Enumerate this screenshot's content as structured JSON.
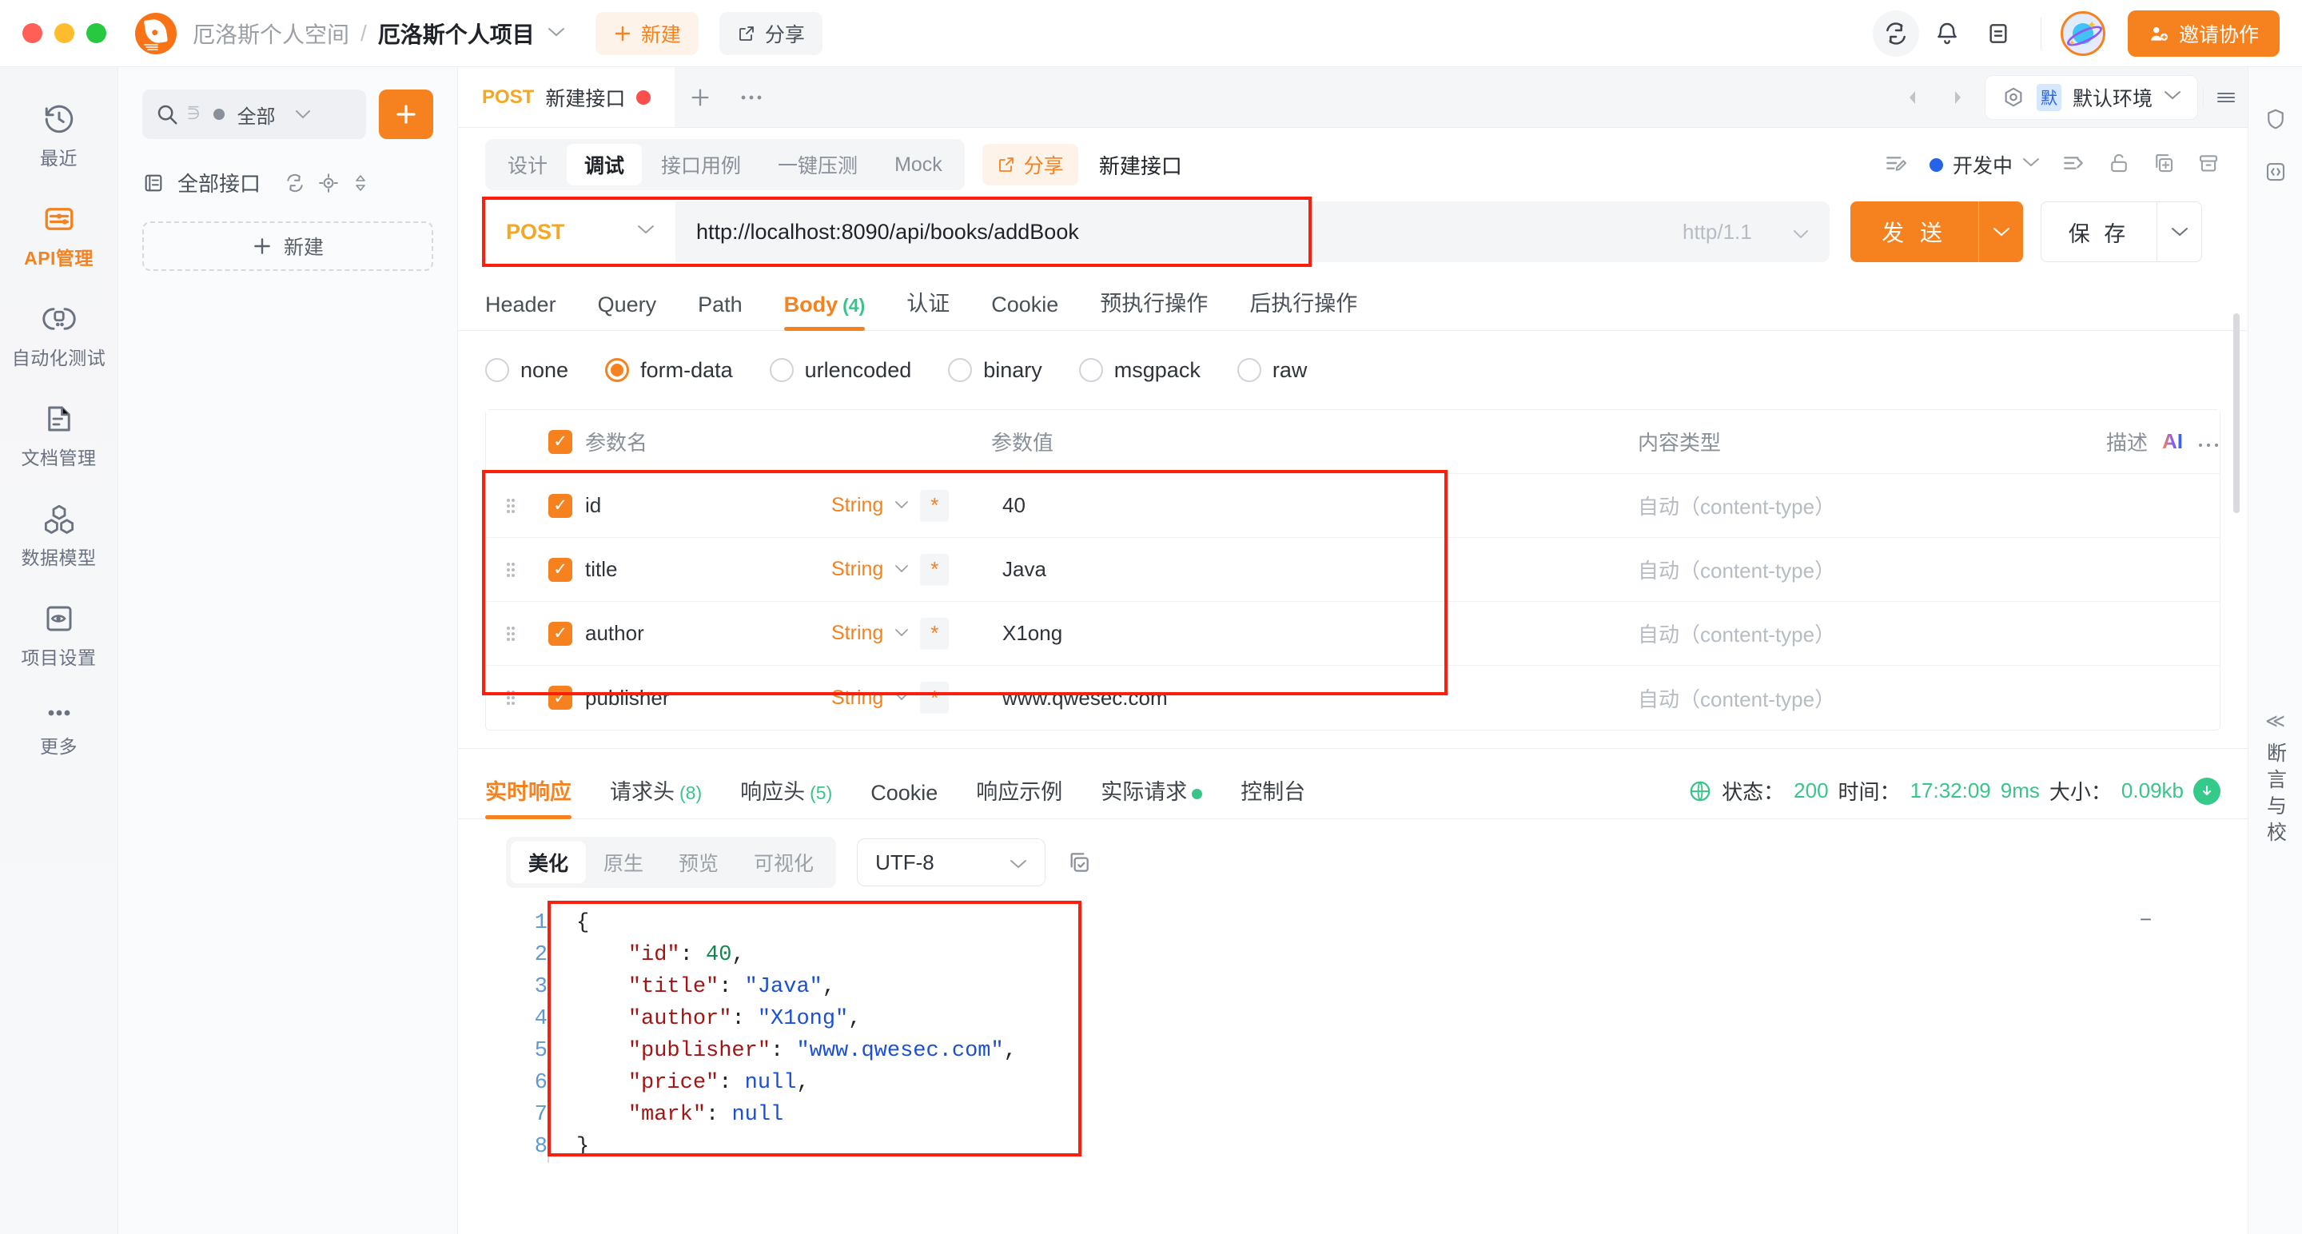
{
  "titlebar": {
    "workspace": "厄洛斯个人空间",
    "separator": "/",
    "project": "厄洛斯个人项目",
    "new_label": "新建",
    "share_label": "分享",
    "invite_label": "邀请协作",
    "icons": [
      "sync-icon",
      "bell-icon",
      "document-icon",
      "avatar"
    ]
  },
  "rail": {
    "items": [
      {
        "label": "最近",
        "icon": "history-icon",
        "active": false
      },
      {
        "label": "API管理",
        "icon": "api-icon",
        "active": true
      },
      {
        "label": "自动化测试",
        "icon": "automation-icon",
        "active": false
      },
      {
        "label": "文档管理",
        "icon": "document-manage-icon",
        "active": false
      },
      {
        "label": "数据模型",
        "icon": "data-model-icon",
        "active": false
      },
      {
        "label": "项目设置",
        "icon": "project-settings-icon",
        "active": false
      },
      {
        "label": "更多",
        "icon": "more-icon",
        "active": false
      }
    ]
  },
  "list_panel": {
    "search_filter": "全部",
    "all_api_label": "全部接口",
    "new_label": "新建"
  },
  "tabstrip": {
    "tab_method": "POST",
    "tab_name": "新建接口",
    "env_badge": "默",
    "env_name": "默认环境"
  },
  "subtabs": {
    "items": [
      {
        "label": "设计",
        "active": false
      },
      {
        "label": "调试",
        "active": true
      },
      {
        "label": "接口用例",
        "active": false
      },
      {
        "label": "一键压测",
        "active": false
      },
      {
        "label": "Mock",
        "active": false
      }
    ],
    "share_label": "分享",
    "interface_name": "新建接口",
    "status_label": "开发中"
  },
  "request": {
    "method": "POST",
    "url": "http://localhost:8090/api/books/addBook",
    "http_version": "http/1.1",
    "send_label": "发 送",
    "save_label": "保 存"
  },
  "param_tabs": [
    {
      "label": "Header",
      "count": "",
      "active": false
    },
    {
      "label": "Query",
      "count": "",
      "active": false
    },
    {
      "label": "Path",
      "count": "",
      "active": false
    },
    {
      "label": "Body",
      "count": "(4)",
      "active": true
    },
    {
      "label": "认证",
      "count": "",
      "active": false
    },
    {
      "label": "Cookie",
      "count": "",
      "active": false
    },
    {
      "label": "预执行操作",
      "count": "",
      "active": false
    },
    {
      "label": "后执行操作",
      "count": "",
      "active": false
    }
  ],
  "body_types": [
    {
      "label": "none",
      "selected": false
    },
    {
      "label": "form-data",
      "selected": true
    },
    {
      "label": "urlencoded",
      "selected": false
    },
    {
      "label": "binary",
      "selected": false
    },
    {
      "label": "msgpack",
      "selected": false
    },
    {
      "label": "raw",
      "selected": false
    }
  ],
  "param_table": {
    "headers": {
      "name": "参数名",
      "value": "参数值",
      "content_type": "内容类型",
      "description": "描述",
      "ai": "AI"
    },
    "rows": [
      {
        "name": "id",
        "type": "String",
        "required": "*",
        "value": "40",
        "content_type": "自动（content-type）"
      },
      {
        "name": "title",
        "type": "String",
        "required": "*",
        "value": "Java",
        "content_type": "自动（content-type）"
      },
      {
        "name": "author",
        "type": "String",
        "required": "*",
        "value": "X1ong",
        "content_type": "自动（content-type）"
      },
      {
        "name": "publisher",
        "type": "String",
        "required": "*",
        "value": "www.qwesec.com",
        "content_type": "自动（content-type）"
      }
    ]
  },
  "response_tabs": [
    {
      "label": "实时响应",
      "count": "",
      "active": true,
      "dot": false
    },
    {
      "label": "请求头",
      "count": "(8)",
      "active": false,
      "dot": false
    },
    {
      "label": "响应头",
      "count": "(5)",
      "active": false,
      "dot": false
    },
    {
      "label": "Cookie",
      "count": "",
      "active": false,
      "dot": false
    },
    {
      "label": "响应示例",
      "count": "",
      "active": false,
      "dot": false
    },
    {
      "label": "实际请求",
      "count": "",
      "active": false,
      "dot": true
    },
    {
      "label": "控制台",
      "count": "",
      "active": false,
      "dot": false
    }
  ],
  "response_meta": {
    "status_label": "状态：",
    "status_value": "200",
    "time_label": "时间：",
    "time_value": "17:32:09",
    "duration": "9ms",
    "size_label": "大小：",
    "size_value": "0.09kb"
  },
  "code_toolbar": {
    "views": [
      {
        "label": "美化",
        "active": true
      },
      {
        "label": "原生",
        "active": false
      },
      {
        "label": "预览",
        "active": false
      },
      {
        "label": "可视化",
        "active": false
      }
    ],
    "encoding": "UTF-8"
  },
  "response_body": {
    "line_numbers": [
      "1",
      "2",
      "3",
      "4",
      "5",
      "6",
      "7",
      "8"
    ],
    "json": {
      "id": 40,
      "title": "Java",
      "author": "X1ong",
      "publisher": "www.qwesec.com",
      "price": null,
      "mark": null
    },
    "lines": [
      "{",
      "    \"id\": 40,",
      "    \"title\": \"Java\",",
      "    \"author\": \"X1ong\",",
      "    \"publisher\": \"www.qwesec.com\",",
      "    \"price\": null,",
      "    \"mark\": null",
      "}"
    ]
  },
  "right_edge": {
    "vertical_label": "断言与校"
  },
  "colors": {
    "accent": "#f5821f",
    "method": "#f5a623",
    "success": "#3bc48a",
    "highlight": "#fc1f0d",
    "dev_status": "#2563eb"
  }
}
